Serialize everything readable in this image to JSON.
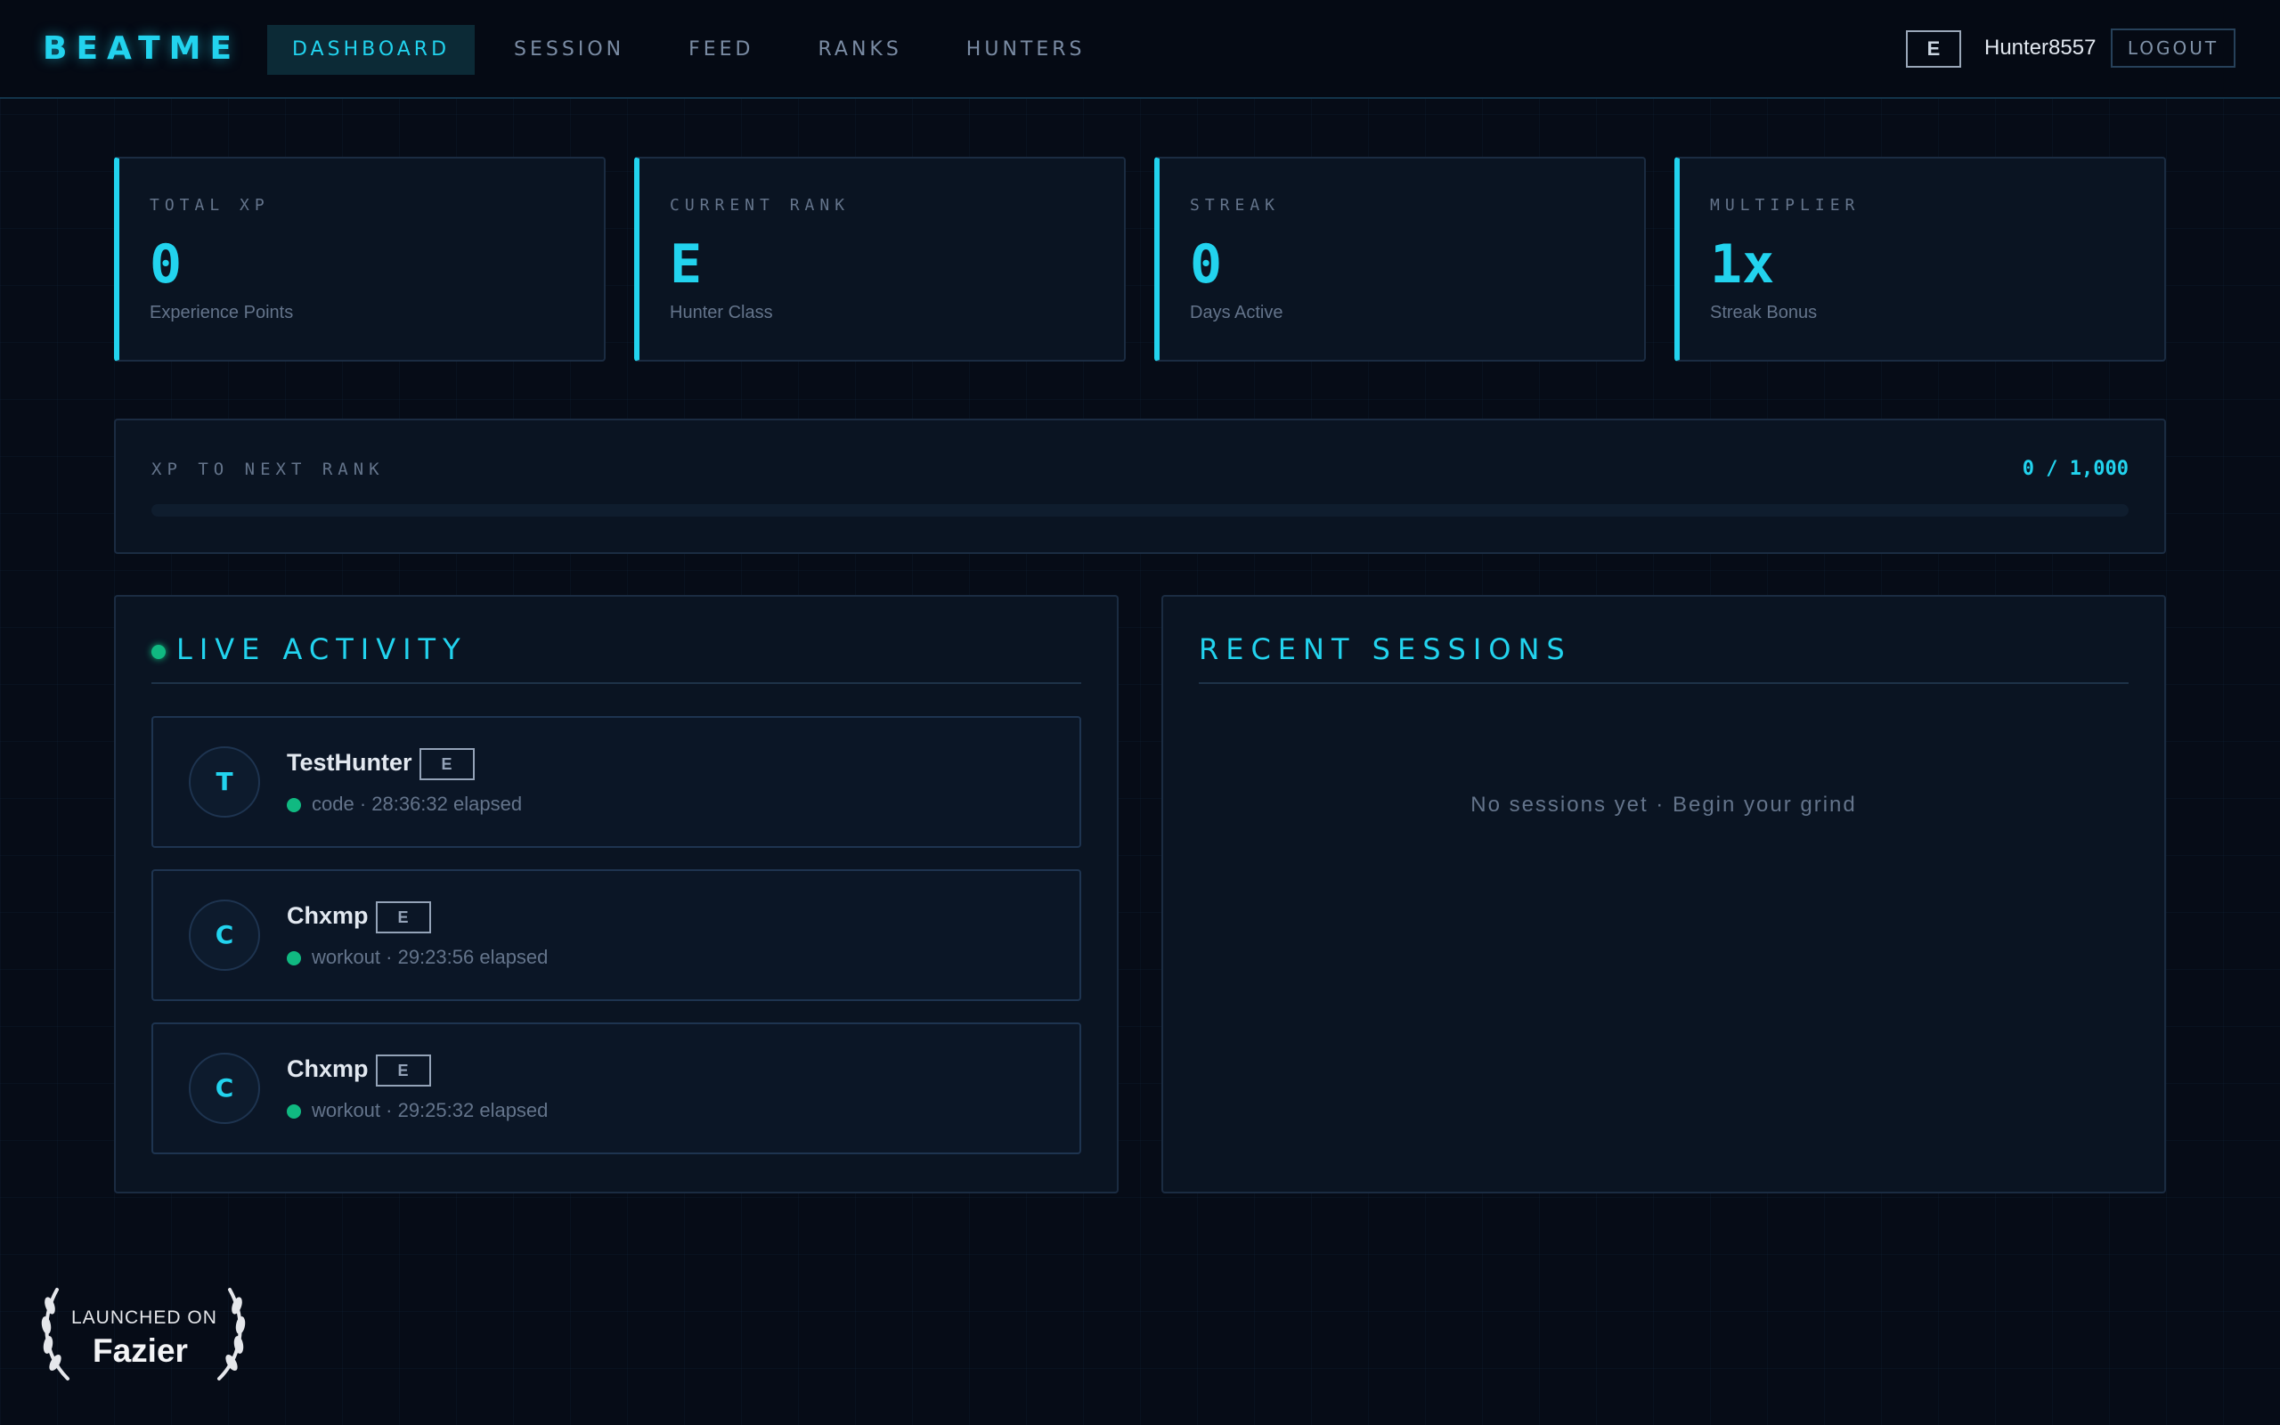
{
  "header": {
    "logo": "BEATME",
    "nav": [
      {
        "label": "DASHBOARD",
        "active": true
      },
      {
        "label": "SESSION",
        "active": false
      },
      {
        "label": "FEED",
        "active": false
      },
      {
        "label": "RANKS",
        "active": false
      },
      {
        "label": "HUNTERS",
        "active": false
      }
    ],
    "rank_badge": "E",
    "username": "Hunter8557",
    "logout_label": "LOGOUT"
  },
  "stats": [
    {
      "label": "TOTAL XP",
      "value": "0",
      "sub": "Experience Points"
    },
    {
      "label": "CURRENT RANK",
      "value": "E",
      "sub": "Hunter Class"
    },
    {
      "label": "STREAK",
      "value": "0",
      "sub": "Days Active"
    },
    {
      "label": "MULTIPLIER",
      "value": "1x",
      "sub": "Streak Bonus"
    }
  ],
  "progress": {
    "label": "XP TO NEXT RANK",
    "value_text": "0 / 1,000",
    "fraction": 0
  },
  "live_activity": {
    "title": "LIVE ACTIVITY",
    "items": [
      {
        "initial": "T",
        "name": "TestHunter",
        "rank": "E",
        "status": "code · 28:36:32 elapsed"
      },
      {
        "initial": "C",
        "name": "Chxmp",
        "rank": "E",
        "status": "workout · 29:23:56 elapsed"
      },
      {
        "initial": "C",
        "name": "Chxmp",
        "rank": "E",
        "status": "workout · 29:25:32 elapsed"
      }
    ]
  },
  "recent_sessions": {
    "title": "RECENT SESSIONS",
    "empty_message": "No sessions yet · Begin your grind"
  },
  "launch_badge": {
    "top": "LAUNCHED ON",
    "name": "Fazier"
  },
  "colors": {
    "accent": "#22d3ee",
    "live": "#10b981",
    "background": "#060c17"
  }
}
